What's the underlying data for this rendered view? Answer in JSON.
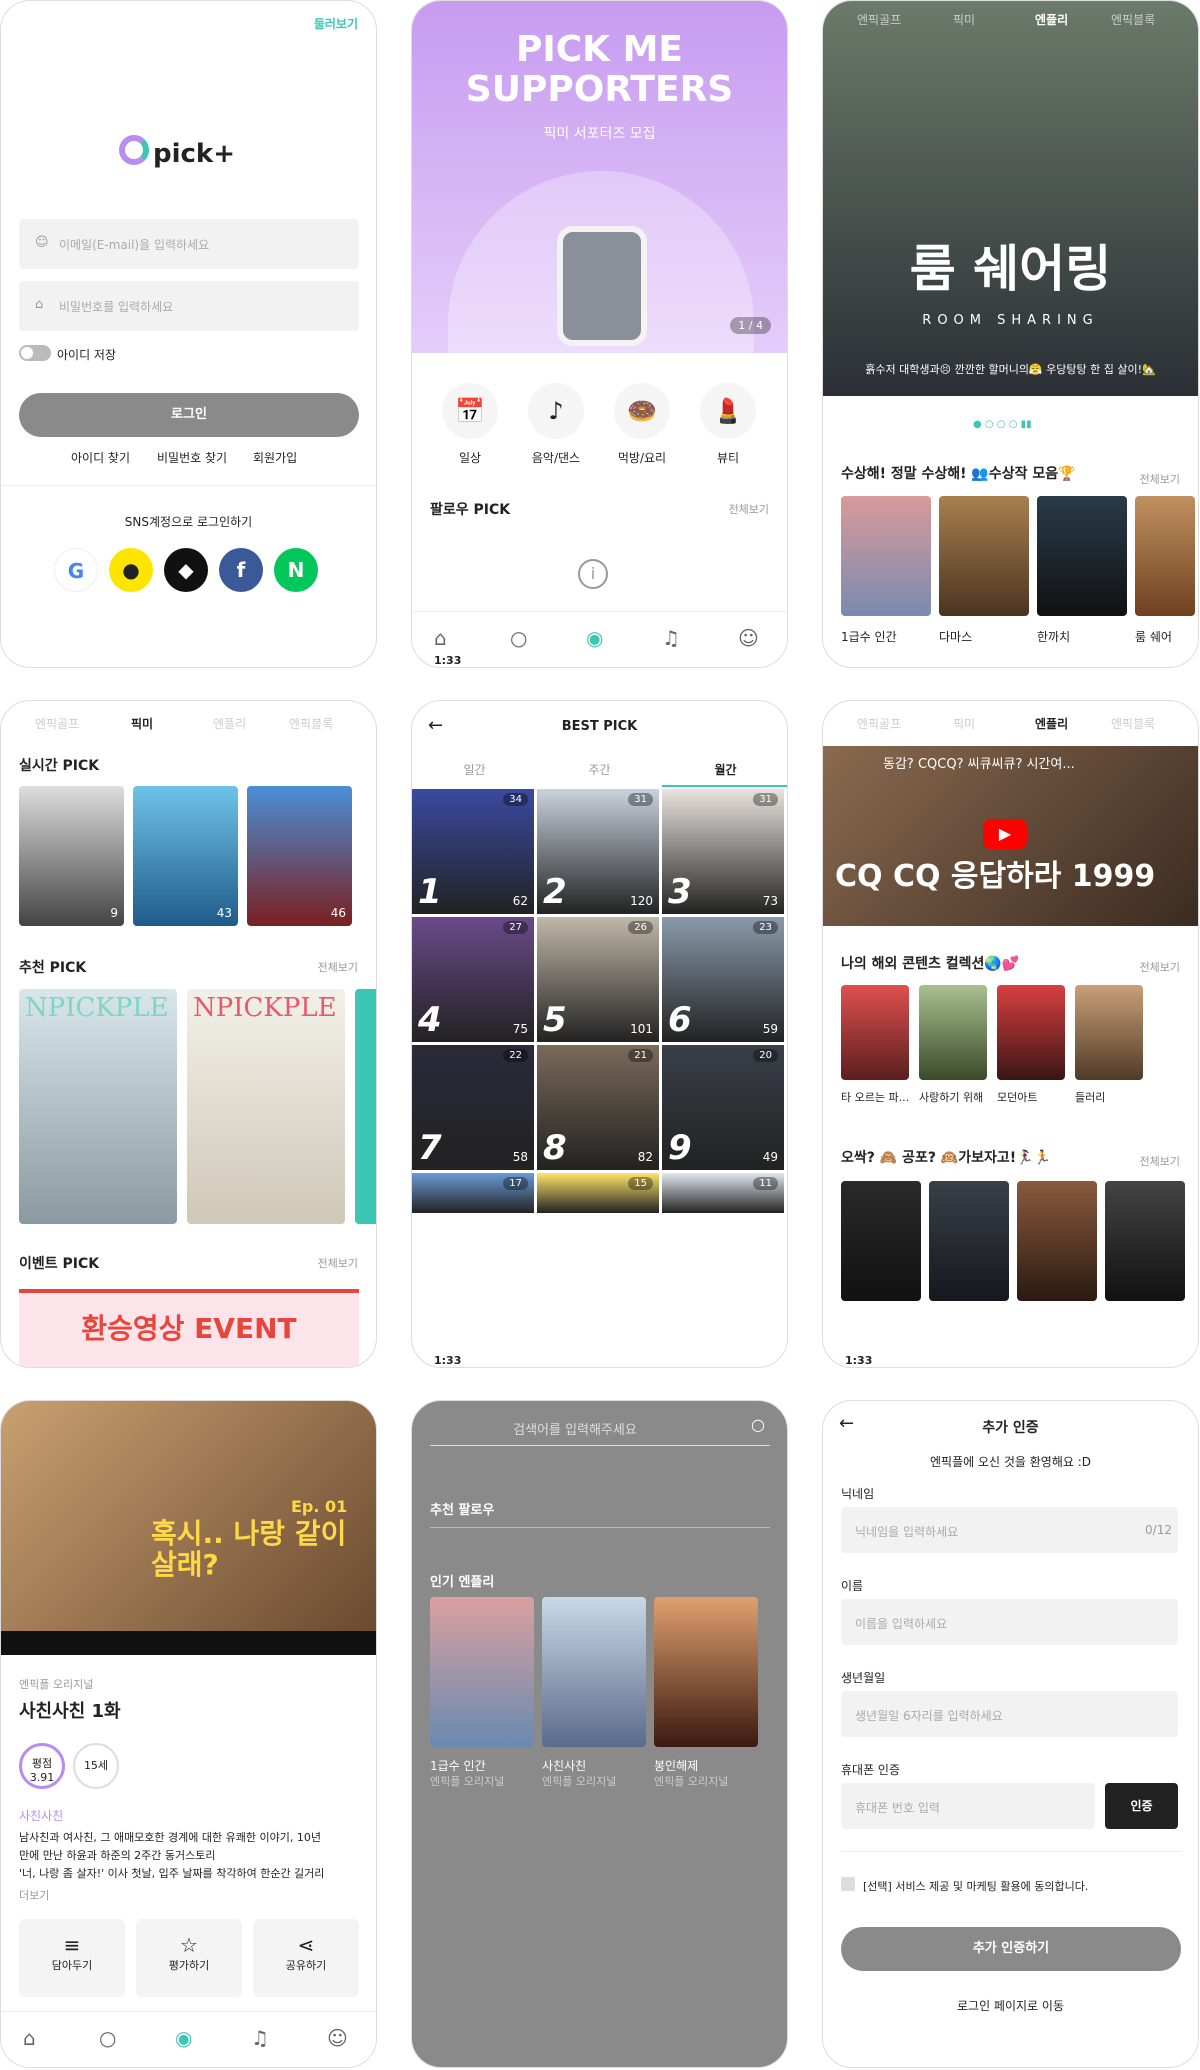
{
  "login": {
    "skip": "둘러보기",
    "logo": "pick+",
    "email_ph": "이메일(E-mail)을 입력하세요",
    "pw_ph": "비밀번호를 입력하세요",
    "save_id": "아이디 저장",
    "login_btn": "로그인",
    "find_id": "아이디 찾기",
    "find_pw": "비밀번호 찾기",
    "signup": "회원가입",
    "sns_title": "SNS계정으로 로그인하기"
  },
  "home": {
    "banner_title1": "PICK ME",
    "banner_title2": "SUPPORTERS",
    "banner_sub": "픽미 서포터즈 모집",
    "page": "1 / 4",
    "cats": [
      "일상",
      "음악/댄스",
      "먹방/요리",
      "뷰티"
    ],
    "follow_title": "팔로우 PICK",
    "see_all": "전체보기",
    "time": "1:33"
  },
  "enple": {
    "tabs": [
      "엔픽골프",
      "픽미",
      "엔플리",
      "엔픽블록"
    ],
    "hero_title": "룸 쉐어링",
    "hero_en": "ROOM SHARING",
    "hero_caption": "흙수저 대학생과😣 깐깐한 할머니의😤 우당탕탕 한 집 살이!🏡",
    "section": "수상해! 정말 수상해! 👥수상작 모음🏆",
    "see_all": "전체보기",
    "items": [
      "1급수 인간",
      "다마스",
      "한까치",
      "룸 쉐어"
    ]
  },
  "pickme": {
    "tabs": [
      "엔픽골프",
      "픽미",
      "엔플리",
      "엔픽블록"
    ],
    "realtime": "실시간 PICK",
    "rt_views": [
      "9",
      "43",
      "46"
    ],
    "rec": "추천 PICK",
    "see_all": "전체보기",
    "mag": "NPICKPLE",
    "event": "이벤트 PICK",
    "event_banner": "환승영상 EVENT"
  },
  "best": {
    "title": "BEST PICK",
    "tabs": [
      "일간",
      "주간",
      "월간"
    ],
    "hearts": [
      "34",
      "31",
      "31",
      "27",
      "26",
      "23",
      "22",
      "21",
      "20",
      "17",
      "15",
      "11"
    ],
    "views": [
      "62",
      "120",
      "73",
      "75",
      "101",
      "59",
      "58",
      "82",
      "49"
    ],
    "nums": [
      "1",
      "2",
      "3",
      "4",
      "5",
      "6",
      "7",
      "8",
      "9"
    ],
    "time": "1:33"
  },
  "enple2": {
    "tabs": [
      "엔픽골프",
      "픽미",
      "엔플리",
      "엔픽블록"
    ],
    "video_title": "동감? CQCQ? 씨큐씨큐? 시간여...",
    "video_big": "CQ CQ 응답하라 1999",
    "section1": "나의 해외 콘텐츠 컬렉션🌏💕",
    "items1": [
      "타 오르는 파...",
      "사랑하기 위해",
      "모던아트",
      "들러리"
    ],
    "section2": "오싹? 🙈 공포? 🙉가보자고!🏃‍♀️🏃",
    "see_all": "전체보기",
    "time": "1:33"
  },
  "detail": {
    "hero_text": "혹시.. 나랑 같이살래?",
    "ep": "Ep. 01",
    "label": "엔픽플 오리지널",
    "title": "사친사친 1화",
    "score_label": "평점",
    "score": "3.91",
    "age": "15세",
    "series": "사친사친",
    "desc1": "남사친과 여사친, 그 애매모호한 경계에 대한 유쾌한 이야기, 10년",
    "desc2": "만에 만난 하윤과 하준의 2주간 동거스토리",
    "desc3": "'너, 나랑 좀 살자!' 이사 첫날, 입주 날짜를 착각하여 한순간 길거리",
    "more": "더보기",
    "actions": [
      "담아두기",
      "평가하기",
      "공유하기"
    ]
  },
  "search": {
    "ph": "검색어를 입력해주세요",
    "rec_follow": "추천 팔로우",
    "popular": "인기 엔플리",
    "items": [
      {
        "t": "1급수 인간",
        "s": "엔픽플 오리지널"
      },
      {
        "t": "사친사친",
        "s": "엔픽플 오리지널"
      },
      {
        "t": "봉인해제",
        "s": "엔픽플 오리지널"
      }
    ]
  },
  "verify": {
    "title": "추가 인증",
    "welcome": "엔픽플에 오신 것을 환영해요 :D",
    "nick_l": "닉네임",
    "nick_ph": "닉네임을 입력하세요",
    "nick_cnt": "0/12",
    "name_l": "이름",
    "name_ph": "이름을 입력하세요",
    "birth_l": "생년월일",
    "birth_ph": "생년월일 6자리를 입력하세요",
    "phone_l": "휴대폰 인증",
    "phone_ph": "휴대폰 번호 입력",
    "verify_btn": "인증",
    "agree": "[선택] 서비스 제공 및 마케팅 활용에 동의합니다.",
    "submit": "추가 인증하기",
    "back": "로그인 페이지로 이동"
  },
  "colors": {
    "accent": "#3cc6b4",
    "purple": "#b98cf0",
    "event": "#e8453c"
  }
}
